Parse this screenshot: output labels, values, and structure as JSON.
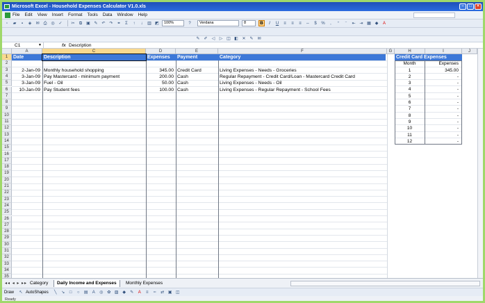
{
  "window": {
    "title": "Microsoft Excel - Household Expenses Calculator V1.0.xls"
  },
  "menu": [
    "File",
    "Edit",
    "View",
    "Insert",
    "Format",
    "Tools",
    "Data",
    "Window",
    "Help"
  ],
  "toolbar": {
    "zoom": "100%",
    "font_name": "Verdana",
    "font_size": "8",
    "bold_label": "B",
    "italic_label": "I",
    "underline_label": "U"
  },
  "formula_bar": {
    "name_box": "C1",
    "fx": "fx",
    "content": "Description"
  },
  "columns": [
    "A",
    "C",
    "D",
    "E",
    "F",
    "G",
    "H",
    "I",
    "J"
  ],
  "rows": [
    "1",
    "2",
    "3",
    "4",
    "5",
    "6",
    "7",
    "8",
    "9",
    "10",
    "11",
    "12",
    "13",
    "14",
    "15",
    "16",
    "17",
    "18",
    "19",
    "20",
    "21",
    "22",
    "23",
    "24",
    "25",
    "26",
    "27",
    "28",
    "29",
    "30",
    "31",
    "32",
    "33",
    "34",
    "35"
  ],
  "table": {
    "headers": {
      "date": "Date",
      "description": "Description",
      "expenses": "Expenses",
      "payment": "Payment",
      "category": "Category"
    },
    "rows": [
      {
        "date": "",
        "description": "",
        "expenses": "",
        "payment": "",
        "category": ""
      },
      {
        "date": "2-Jan-09",
        "description": "Monthly household shopping",
        "expenses": "345.00",
        "payment": "Credit Card",
        "category": "Living Expenses - Needs - Groceries"
      },
      {
        "date": "3-Jan-09",
        "description": "Pay Mastercard - minimum payment",
        "expenses": "200.00",
        "payment": "Cash",
        "category": "Regular Repayment - Credit Card/Loan - Mastercard Credit Card"
      },
      {
        "date": "3-Jan-09",
        "description": "Fuel - Oil",
        "expenses": "50.00",
        "payment": "Cash",
        "category": "Living Expenses - Needs - Oil"
      },
      {
        "date": "10-Jan-09",
        "description": "Pay Student fees",
        "expenses": "100.00",
        "payment": "Cash",
        "category": "Living Expenses - Regular Repayment - School Fees"
      }
    ]
  },
  "credit_card": {
    "title": "Credit Card Expenses",
    "col_month": "Month",
    "col_expenses": "Expenses",
    "rows": [
      {
        "month": "1",
        "expenses": "345.00"
      },
      {
        "month": "2",
        "expenses": "-"
      },
      {
        "month": "3",
        "expenses": "-"
      },
      {
        "month": "4",
        "expenses": "-"
      },
      {
        "month": "5",
        "expenses": "-"
      },
      {
        "month": "6",
        "expenses": "-"
      },
      {
        "month": "7",
        "expenses": "-"
      },
      {
        "month": "8",
        "expenses": "-"
      },
      {
        "month": "9",
        "expenses": "-"
      },
      {
        "month": "10",
        "expenses": "-"
      },
      {
        "month": "11",
        "expenses": "-"
      },
      {
        "month": "12",
        "expenses": "-"
      }
    ]
  },
  "sheet_tabs": [
    {
      "label": "Category",
      "active": false
    },
    {
      "label": "Daily Income and Expenses",
      "active": true
    },
    {
      "label": "Monthly Expenses",
      "active": false
    }
  ],
  "draw_toolbar": {
    "draw_label": "Draw",
    "autoshapes_label": "AutoShapes"
  },
  "status": {
    "text": "Ready"
  },
  "colors": {
    "header_blue": "#3d78d8",
    "selection_yellow": "#f9d98f",
    "frame_green": "#9fd86a"
  }
}
